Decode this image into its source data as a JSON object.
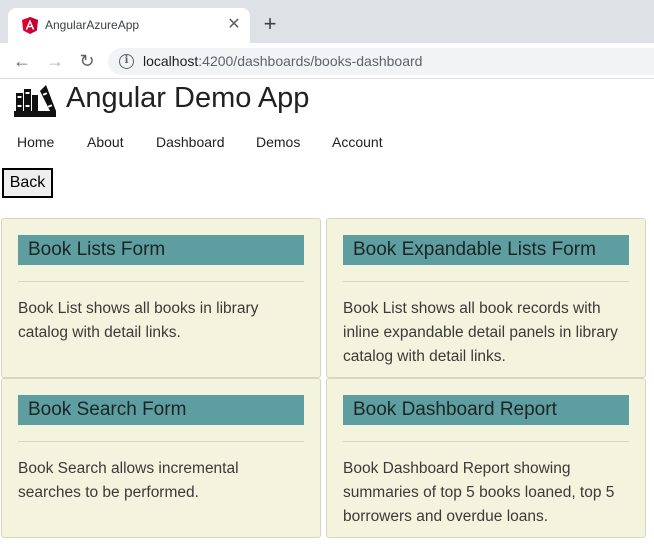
{
  "browser": {
    "tab_title": "AngularAzureApp",
    "tab_close": "✕",
    "new_tab": "+",
    "back": "←",
    "forward": "→",
    "reload": "↻",
    "info": "i",
    "url_host": "localhost",
    "url_path": ":4200/dashboards/books-dashboard"
  },
  "app": {
    "title": "Angular Demo App",
    "nav": [
      "Home",
      "About",
      "Dashboard",
      "Demos",
      "Account"
    ],
    "back_button": "Back"
  },
  "cards": [
    {
      "title": "Book Lists Form",
      "text": "Book List shows all books in library catalog with detail links."
    },
    {
      "title": "Book Expandable Lists Form",
      "text": "Book List shows all book records with inline expandable detail panels in library catalog with detail links."
    },
    {
      "title": "Book Search Form",
      "text": "Book Search allows incremental searches to be performed."
    },
    {
      "title": "Book Dashboard Report",
      "text": "Book Dashboard Report showing summaries of top 5 books loaned, top 5 borrowers and overdue loans."
    }
  ],
  "colors": {
    "card_background": "#f4f3dd",
    "card_header": "#5f9ea0",
    "angular_red": "#dd0031"
  }
}
